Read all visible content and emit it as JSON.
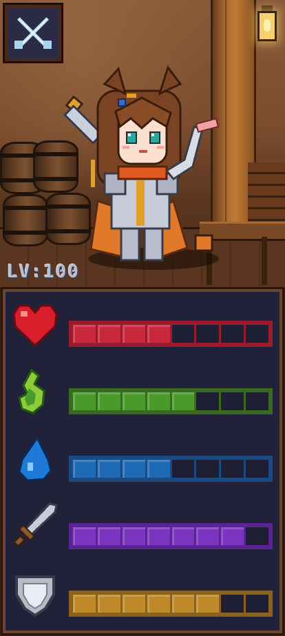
{
  "hud": {
    "level_text": "LV:100",
    "menu_icon": "crossed-swords-icon"
  },
  "stats": [
    {
      "id": "health",
      "icon": "heart-icon",
      "filled": 4,
      "max": 8,
      "fill_color": "#c8283a",
      "empty_color": "#1e1e34",
      "border_color": "#9a1c2c"
    },
    {
      "id": "stamina",
      "icon": "leaf-flame-icon",
      "filled": 5,
      "max": 8,
      "fill_color": "#4a9a2a",
      "empty_color": "#1e1e34",
      "border_color": "#3a6a20"
    },
    {
      "id": "mana",
      "icon": "water-drop-icon",
      "filled": 4,
      "max": 8,
      "fill_color": "#1e6ab6",
      "empty_color": "#1e1e34",
      "border_color": "#1a4a80"
    },
    {
      "id": "attack",
      "icon": "sword-icon",
      "filled": 7,
      "max": 8,
      "fill_color": "#7a34c0",
      "empty_color": "#1e1e34",
      "border_color": "#5a2494"
    },
    {
      "id": "defense",
      "icon": "shield-icon",
      "filled": 6,
      "max": 8,
      "fill_color": "#c08a2a",
      "empty_color": "#1e1e34",
      "border_color": "#8a621c"
    }
  ]
}
